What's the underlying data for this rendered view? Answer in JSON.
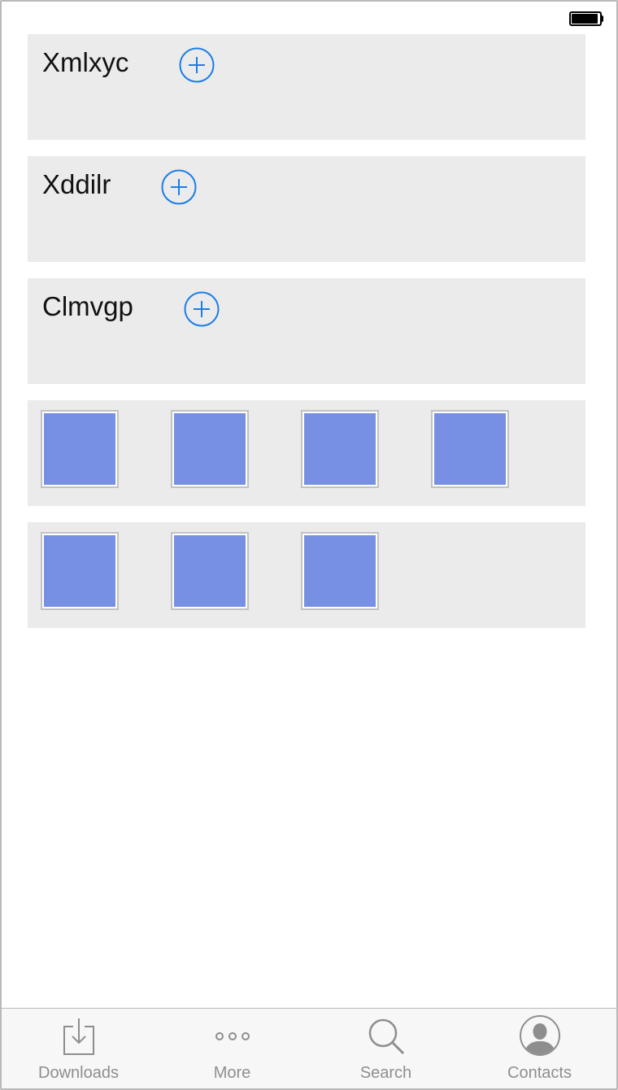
{
  "status_bar": {
    "battery_icon": "battery-full-icon"
  },
  "panels": [
    {
      "title": "Xmlxyc",
      "action_icon": "plus-circle-icon"
    },
    {
      "title": "Xddilr",
      "action_icon": "plus-circle-icon"
    },
    {
      "title": "Clmvgp",
      "action_icon": "plus-circle-icon"
    }
  ],
  "thumbnail_rows": [
    {
      "count": 4,
      "color": "#7890e4"
    },
    {
      "count": 3,
      "color": "#7890e4"
    }
  ],
  "tab_bar": {
    "tabs": [
      {
        "label": "Downloads",
        "icon": "download-tray-icon"
      },
      {
        "label": "More",
        "icon": "more-dots-icon"
      },
      {
        "label": "Search",
        "icon": "magnifier-icon"
      },
      {
        "label": "Contacts",
        "icon": "contact-avatar-icon"
      }
    ]
  },
  "colors": {
    "accent": "#1a7ee6",
    "panel_bg": "#ebebeb",
    "thumbnail_fill": "#7890e4",
    "tab_inactive": "#8e8e8e"
  }
}
